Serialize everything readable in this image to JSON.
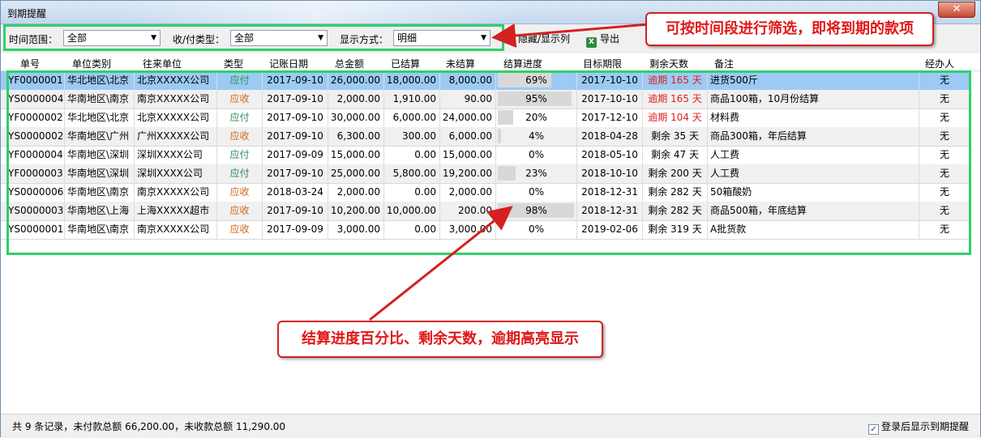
{
  "window": {
    "title": "到期提醒",
    "close_glyph": "✕"
  },
  "toolbar": {
    "time_range_label": "时间范围：",
    "time_range_value": "全部",
    "type_label": "收/付类型：",
    "type_value": "全部",
    "display_label": "显示方式：",
    "display_value": "明细",
    "hide_columns_label": "隐藏/显示列",
    "export_label": "导出",
    "export_icon": "excel-icon"
  },
  "table": {
    "headers": [
      "单号",
      "单位类别",
      "往来单位",
      "类型",
      "记账日期",
      "总金额",
      "已结算",
      "未结算",
      "结算进度",
      "目标期限",
      "剩余天数",
      "备注",
      "经办人"
    ],
    "rows": [
      {
        "no": "YF0000001",
        "region": "华北地区\\北京",
        "company": "北京XXXXX公司",
        "type": "应付",
        "date": "2017-09-10",
        "total": "26,000.00",
        "settled": "18,000.00",
        "unsettled": "8,000.00",
        "progress": "69%",
        "progress_value": 0.69,
        "deadline": "2017-10-10",
        "remaining": "逾期 165 天",
        "overdue": true,
        "note": "进货500斤",
        "handler": "无"
      },
      {
        "no": "YS0000004",
        "region": "华南地区\\南京",
        "company": "南京XXXXX公司",
        "type": "应收",
        "date": "2017-09-10",
        "total": "2,000.00",
        "settled": "1,910.00",
        "unsettled": "90.00",
        "progress": "95%",
        "progress_value": 0.95,
        "deadline": "2017-10-10",
        "remaining": "逾期 165 天",
        "overdue": true,
        "note": "商品100箱，10月份结算",
        "handler": "无"
      },
      {
        "no": "YF0000002",
        "region": "华北地区\\北京",
        "company": "北京XXXXX公司",
        "type": "应付",
        "date": "2017-09-10",
        "total": "30,000.00",
        "settled": "6,000.00",
        "unsettled": "24,000.00",
        "progress": "20%",
        "progress_value": 0.2,
        "deadline": "2017-12-10",
        "remaining": "逾期 104 天",
        "overdue": true,
        "note": "材料费",
        "handler": "无"
      },
      {
        "no": "YS0000002",
        "region": "华南地区\\广州",
        "company": "广州XXXXX公司",
        "type": "应收",
        "date": "2017-09-10",
        "total": "6,300.00",
        "settled": "300.00",
        "unsettled": "6,000.00",
        "progress": "4%",
        "progress_value": 0.04,
        "deadline": "2018-04-28",
        "remaining": "剩余 35 天",
        "overdue": false,
        "note": "商品300箱，年后结算",
        "handler": "无"
      },
      {
        "no": "YF0000004",
        "region": "华南地区\\深圳",
        "company": "深圳XXXX公司",
        "type": "应付",
        "date": "2017-09-09",
        "total": "15,000.00",
        "settled": "0.00",
        "unsettled": "15,000.00",
        "progress": "0%",
        "progress_value": 0,
        "deadline": "2018-05-10",
        "remaining": "剩余 47 天",
        "overdue": false,
        "note": "人工费",
        "handler": "无"
      },
      {
        "no": "YF0000003",
        "region": "华南地区\\深圳",
        "company": "深圳XXXX公司",
        "type": "应付",
        "date": "2017-09-10",
        "total": "25,000.00",
        "settled": "5,800.00",
        "unsettled": "19,200.00",
        "progress": "23%",
        "progress_value": 0.23,
        "deadline": "2018-10-10",
        "remaining": "剩余 200 天",
        "overdue": false,
        "note": "人工费",
        "handler": "无"
      },
      {
        "no": "YS0000006",
        "region": "华南地区\\南京",
        "company": "南京XXXXX公司",
        "type": "应收",
        "date": "2018-03-24",
        "total": "2,000.00",
        "settled": "0.00",
        "unsettled": "2,000.00",
        "progress": "0%",
        "progress_value": 0,
        "deadline": "2018-12-31",
        "remaining": "剩余 282 天",
        "overdue": false,
        "note": "50箱酸奶",
        "handler": "无"
      },
      {
        "no": "YS0000003",
        "region": "华南地区\\上海",
        "company": "上海XXXXX超市",
        "type": "应收",
        "date": "2017-09-10",
        "total": "10,200.00",
        "settled": "10,000.00",
        "unsettled": "200.00",
        "progress": "98%",
        "progress_value": 0.98,
        "deadline": "2018-12-31",
        "remaining": "剩余 282 天",
        "overdue": false,
        "note": "商品500箱，年底结算",
        "handler": "无"
      },
      {
        "no": "YS0000001",
        "region": "华南地区\\南京",
        "company": "南京XXXXX公司",
        "type": "应收",
        "date": "2017-09-09",
        "total": "3,000.00",
        "settled": "0.00",
        "unsettled": "3,000.00",
        "progress": "0%",
        "progress_value": 0,
        "deadline": "2019-02-06",
        "remaining": "剩余 319 天",
        "overdue": false,
        "note": "A批货款",
        "handler": "无"
      }
    ]
  },
  "status": {
    "summary": "共 9 条记录，未付款总额 66,200.00，未收款总额 11,290.00",
    "show_on_login_label": "登录后显示到期提醒",
    "show_on_login_checked": true
  },
  "annotations": {
    "filter_note": "可按时间段进行筛选，即将到期的款项",
    "progress_note": "结算进度百分比、剩余天数，逾期高亮显示"
  },
  "colors": {
    "payable": "#2e8b57",
    "receivable": "#d2691e",
    "overdue": "#e02020",
    "selected_row": "#9ccaf4",
    "highlight_box": "#2fd06a",
    "callout": "#d42020"
  }
}
